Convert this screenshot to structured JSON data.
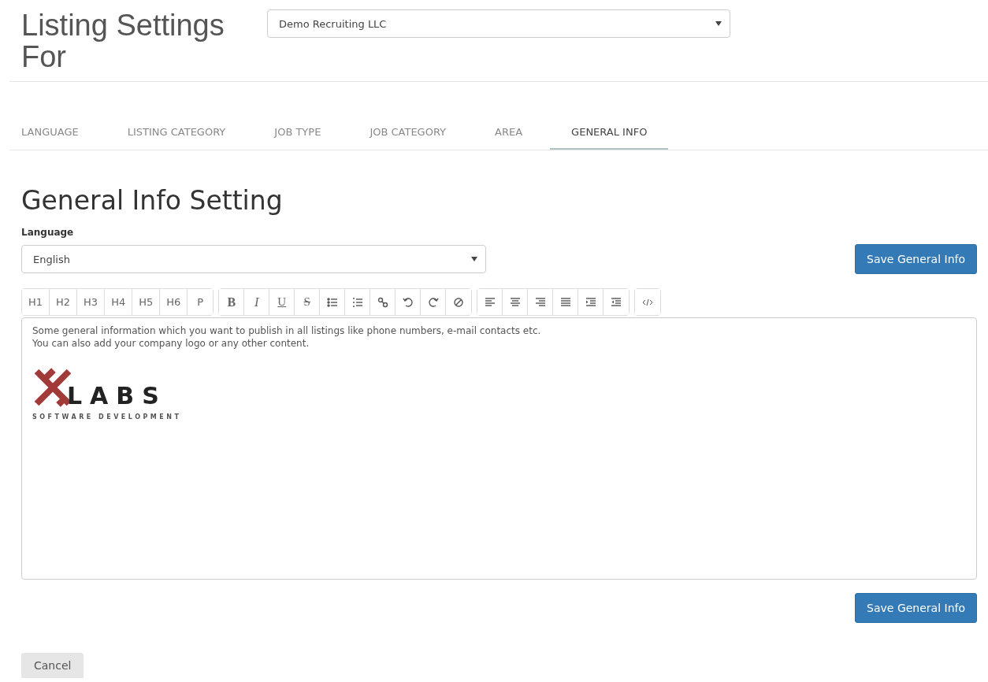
{
  "header": {
    "title": "Listing Settings For",
    "company_select": {
      "value": "Demo Recruiting LLC"
    }
  },
  "tabs": [
    {
      "label": "LANGUAGE",
      "selected": false
    },
    {
      "label": "LISTING CATEGORY",
      "selected": false
    },
    {
      "label": "JOB TYPE",
      "selected": false
    },
    {
      "label": "JOB CATEGORY",
      "selected": false
    },
    {
      "label": "AREA",
      "selected": false
    },
    {
      "label": "GENERAL INFO",
      "selected": true
    }
  ],
  "section": {
    "heading": "General Info Setting",
    "language_label": "Language",
    "language_select": {
      "value": "English"
    },
    "save_button": "Save General Info"
  },
  "toolbar": [
    [
      {
        "kind": "text",
        "label": "H1"
      },
      {
        "kind": "text",
        "label": "H2"
      },
      {
        "kind": "text",
        "label": "H3"
      },
      {
        "kind": "text",
        "label": "H4"
      },
      {
        "kind": "text",
        "label": "H5"
      },
      {
        "kind": "text",
        "label": "H6"
      },
      {
        "kind": "text",
        "label": "P"
      }
    ],
    [
      {
        "kind": "bold",
        "label": "B"
      },
      {
        "kind": "italic",
        "label": "I"
      },
      {
        "kind": "underline",
        "label": "U"
      },
      {
        "kind": "strike",
        "label": "S"
      },
      {
        "kind": "bullets"
      },
      {
        "kind": "numbers"
      },
      {
        "kind": "link"
      },
      {
        "kind": "undo"
      },
      {
        "kind": "redo"
      },
      {
        "kind": "clear"
      }
    ],
    [
      {
        "kind": "alignleft"
      },
      {
        "kind": "aligncenter"
      },
      {
        "kind": "alignright"
      },
      {
        "kind": "justify"
      },
      {
        "kind": "indent"
      },
      {
        "kind": "outdent"
      }
    ],
    [
      {
        "kind": "code"
      }
    ]
  ],
  "editor": {
    "lines": [
      "Some general information which you want to publish in all listings like phone numbers, e-mail contacts etc.",
      "You can also add your company logo or any other content."
    ],
    "logo": {
      "word": "LABS",
      "tagline": "SOFTWARE DEVELOPMENT"
    }
  },
  "bottom_save_button": "Save General Info",
  "cancel_button": "Cancel"
}
